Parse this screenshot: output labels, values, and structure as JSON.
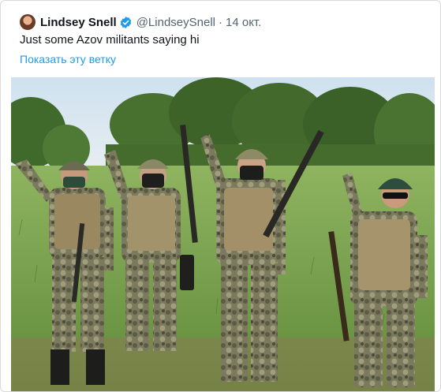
{
  "tweet": {
    "author_name": "Lindsey Snell",
    "author_handle": "@LindseySnell",
    "separator": "·",
    "date": "14 окт.",
    "verified_icon": "verified-badge-icon",
    "text": "Just some Azov militants saying hi",
    "thread_link": "Показать эту ветку",
    "colors": {
      "link": "#1d9bf0",
      "verified": "#1d9bf0",
      "text": "#0f1419",
      "secondary": "#536471"
    }
  },
  "media": {
    "subject": "photo"
  }
}
